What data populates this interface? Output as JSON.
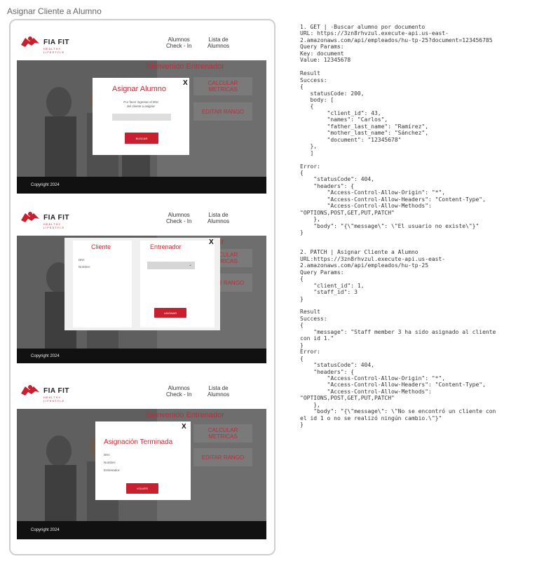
{
  "page": {
    "title": "Asignar Cliente a Alumno"
  },
  "brand": {
    "name": "FIA FIT",
    "tagline": "HEALTHY LIFESTYLE"
  },
  "nav": {
    "check_in_line1": "Alumnos",
    "check_in_line2": "Check - In",
    "list_line1": "Lista de",
    "list_line2": "Alumnos"
  },
  "hero": {
    "welcome": "Bienvenido Entrenador",
    "calc_line1": "CALCULAR",
    "calc_line2": "METRICAS",
    "edit_rank": "EDITAR RANGO"
  },
  "footer": {
    "copyright": "Copyright 2024"
  },
  "modal_assign": {
    "title": "Asignar Alumno",
    "close": "X",
    "prompt_line1": "Por favor ingresar el DNI",
    "prompt_line2": "del cliente a asignar",
    "search_button": "BUSCAR"
  },
  "modal_client": {
    "client_title": "Cliente",
    "dni_label": "DNI:",
    "name_label": "Nombre:",
    "trainer_title": "Entrenador",
    "close": "X",
    "assign_button": "ASIGNAR"
  },
  "modal_done": {
    "title": "Asignación Terminada",
    "close": "X",
    "dni_label": "DNI:",
    "name_label": "Nombre:",
    "trainer_label": "Entrenador:",
    "back_button": "VOLVER"
  },
  "spec": {
    "text": "1. GET | -Buscar alumno por documento\nURL: https://3zn8rhvzul.execute-api.us-east-\n2.amazonaws.com/api/empleados/hu-tp-25?document=123456785\nQuery Params:\nKey: document\nValue: 12345678\n\nResult\nSuccess:\n{\n   statusCode: 200,\n   body: [\n   {\n        \"client_id\": 43,\n        \"names\": \"Carlos\",\n        \"father_last_name\": \"Ramírez\",\n        \"mother_last_name\": \"Sánchez\",\n        \"document\": \"12345678\"\n   },\n   ]\n\nError:\n{\n    \"statusCode\": 404,\n    \"headers\": {\n        \"Access-Control-Allow-Origin\": \"*\",\n        \"Access-Control-Allow-Headers\": \"Content-Type\",\n        \"Access-Control-Allow-Methods\":\n\"OPTIONS,POST,GET,PUT,PATCH\"\n    },\n    \"body\": \"{\\\"message\\\": \\\"El usuario no existe\\\"}\"\n}\n\n\n2. PATCH | Asignar Cliente a Alumno\nURL:https://3zn8rhvzul.execute-api.us-east-\n2.amazonaws.com/api/empleados/hu-tp-25\nQuery Params:\n{\n    \"client_id\": 1,\n    \"staff_id\": 3\n}\n\nResult\nSuccess:\n{\n    \"message\": \"Staff member 3 ha sido asignado al cliente\ncon id 1.\"\n}\nError:\n{\n    \"statusCode\": 404,\n    \"headers\": {\n        \"Access-Control-Allow-Origin\": \"*\",\n        \"Access-Control-Allow-Headers\": \"Content-Type\",\n        \"Access-Control-Allow-Methods\":\n\"OPTIONS,POST,GET,PUT,PATCH\"\n    },\n    \"body\": \"{\\\"message\\\": \\\"No se encontró un cliente con\nel id 1 o no se realizó ningún cambio.\\\"}\"\n}"
  },
  "colors": {
    "brand_red": "#c8202f",
    "overlay_grey": "#6e6e6e",
    "footer_black": "#111111"
  },
  "icons": {
    "logo": "fia-fit-logo-icon",
    "close": "close-icon",
    "dropdown": "chevron-down-icon"
  }
}
